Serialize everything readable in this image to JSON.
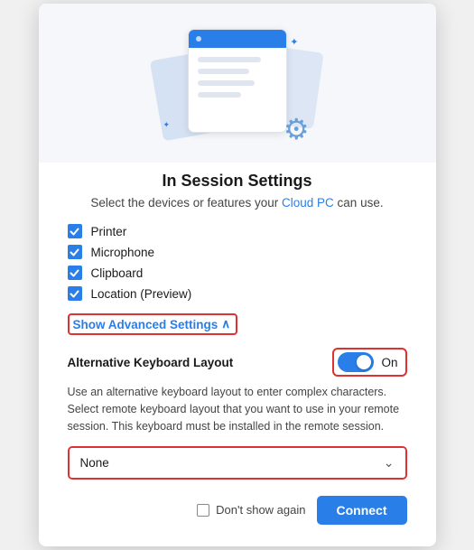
{
  "dialog": {
    "title": "In Session Settings",
    "subtitle_text": "Select the devices or features your ",
    "subtitle_link": "Cloud PC",
    "subtitle_end": " can use.",
    "checkboxes": [
      {
        "label": "Printer",
        "checked": true
      },
      {
        "label": "Microphone",
        "checked": true
      },
      {
        "label": "Clipboard",
        "checked": true
      },
      {
        "label": "Location (Preview)",
        "checked": true
      }
    ],
    "show_advanced_label": "Show Advanced Settings",
    "show_advanced_icon": "∧",
    "advanced": {
      "label": "Alternative Keyboard Layout",
      "toggle_state": "On",
      "description": "Use an alternative keyboard layout to enter complex characters. Select remote keyboard layout that you want to use in your remote session. This keyboard must be installed in the remote session."
    },
    "dropdown": {
      "value": "None",
      "placeholder": "None"
    },
    "footer": {
      "dont_show_label": "Don't show again",
      "connect_label": "Connect"
    }
  }
}
